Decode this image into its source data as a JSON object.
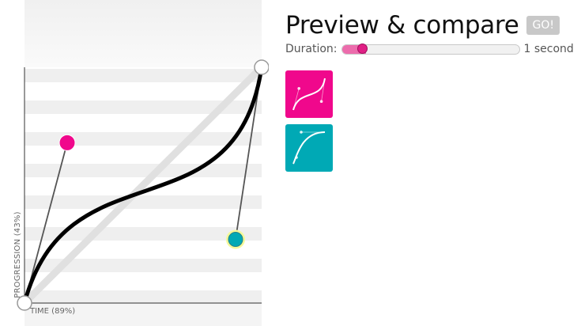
{
  "editor": {
    "y_label": "PROGRESSION (43%)",
    "x_label": "TIME (89%)",
    "curve": [
      0.18,
      0.68,
      0.89,
      0.27
    ]
  },
  "preview": {
    "title": "Preview & compare",
    "go_label": "GO!",
    "duration_label": "Duration:",
    "duration_value": "1 second",
    "duration_seconds": 1
  },
  "library": [
    {
      "name": "current-curve",
      "color": "#f0088c",
      "curve": [
        0.18,
        0.68,
        0.89,
        0.27
      ]
    },
    {
      "name": "comparison-curve",
      "color": "#00a9b5",
      "curve": [
        0.1,
        0.2,
        0.25,
        1.0
      ]
    }
  ],
  "colors": {
    "handle_p1": "#f0088c",
    "handle_p2": "#00a9b5",
    "curve": "#000000"
  }
}
